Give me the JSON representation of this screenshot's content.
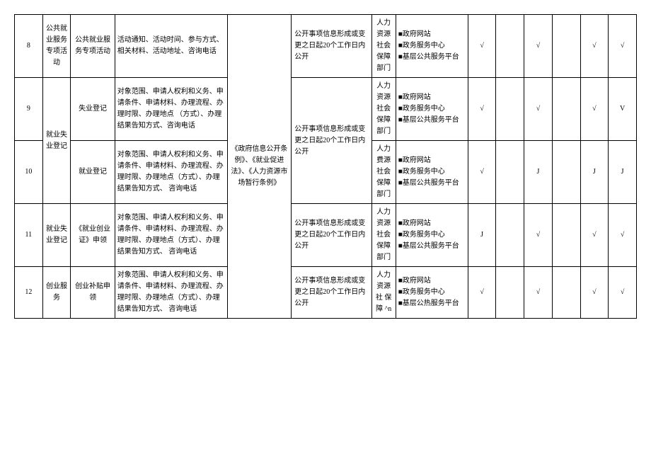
{
  "rows": [
    {
      "num": "8",
      "category": "公共就业服务专项活动",
      "subitem": "公共就业服务专项活动",
      "content": "活动通知、活动时间、参与方式、相关材料、活动地址、咨询电话",
      "time": "公开事项信息形成或变更之日起20个工作日内公开",
      "dept": "人力资源社会保障部门",
      "channels": [
        "■政府网站",
        "■政务服务中心",
        "■基层公共服务平台"
      ],
      "checks": [
        "√",
        "",
        "√",
        "",
        "√",
        "√"
      ]
    },
    {
      "num": "9",
      "category": "就业失业登记",
      "subitem": "失业登记",
      "content": "对象范围、申请人权利和义务、申请条件、申请材料、办理流程、办理时限、办理地点\n（方式）、办理结果告知方式、咨询电话",
      "time": "公开事项信息形成或变更之日起20个工作日内公开",
      "dept": "人力资源社会保障部门",
      "channels": [
        "■政府网站",
        "■政务服务中心",
        "■基层公共服务平台"
      ],
      "checks": [
        "√",
        "",
        "√",
        "",
        "√",
        "V"
      ]
    },
    {
      "num": "10",
      "category": "",
      "subitem": "就业登记",
      "content": "对象范围、申请人权利和义务、申请条件、申请材料、办理流程、办理时限、办理地点（方式）、办理结果告知方式、\n咨询电话",
      "time": "",
      "dept": "人力费源社会保障部门",
      "channels": [
        "■政府网站",
        "■政务服务中心",
        "■基层公共服务平台"
      ],
      "checks": [
        "√",
        "",
        "J",
        "",
        "J",
        "J"
      ]
    },
    {
      "num": "11",
      "category": "就业失业登记",
      "subitem": "《就业创业证》申领",
      "content": "对象范围、申请人权利和义务、申请条件、申请材料、办理流程、办理时限、办理地点（方式）、办理结果告知方式、\n咨询电话",
      "basis": "《政府信息公开条例》、《就业促进法》、《人力资源市场暂行条例》",
      "time": "公开事项信息形成或变更之日起20个工作日内公开",
      "dept": "人力资源社会保障部门",
      "channels": [
        "■政府网站",
        "■政务服务中心",
        "■基层公共服务平台"
      ],
      "checks": [
        "J",
        "",
        "√",
        "",
        "√",
        "√"
      ]
    },
    {
      "num": "12",
      "category": "创业服务",
      "subitem": "创业补贴申领",
      "content": "对象范围、申请人权利和义务、申请条件、申请材料、办理流程、办理时限、办理地点（方式）、办理结果告知方式、\n咨询电话",
      "time": "公开事项信息形成或变更之日起20个工作日内公开",
      "dept": "人力资源社 保 障\n^n",
      "channels": [
        "■政府网站",
        "■政务服务中心",
        "■基层公热服务平台"
      ],
      "checks": [
        "√",
        "",
        "√",
        "",
        "√",
        "√"
      ]
    }
  ]
}
